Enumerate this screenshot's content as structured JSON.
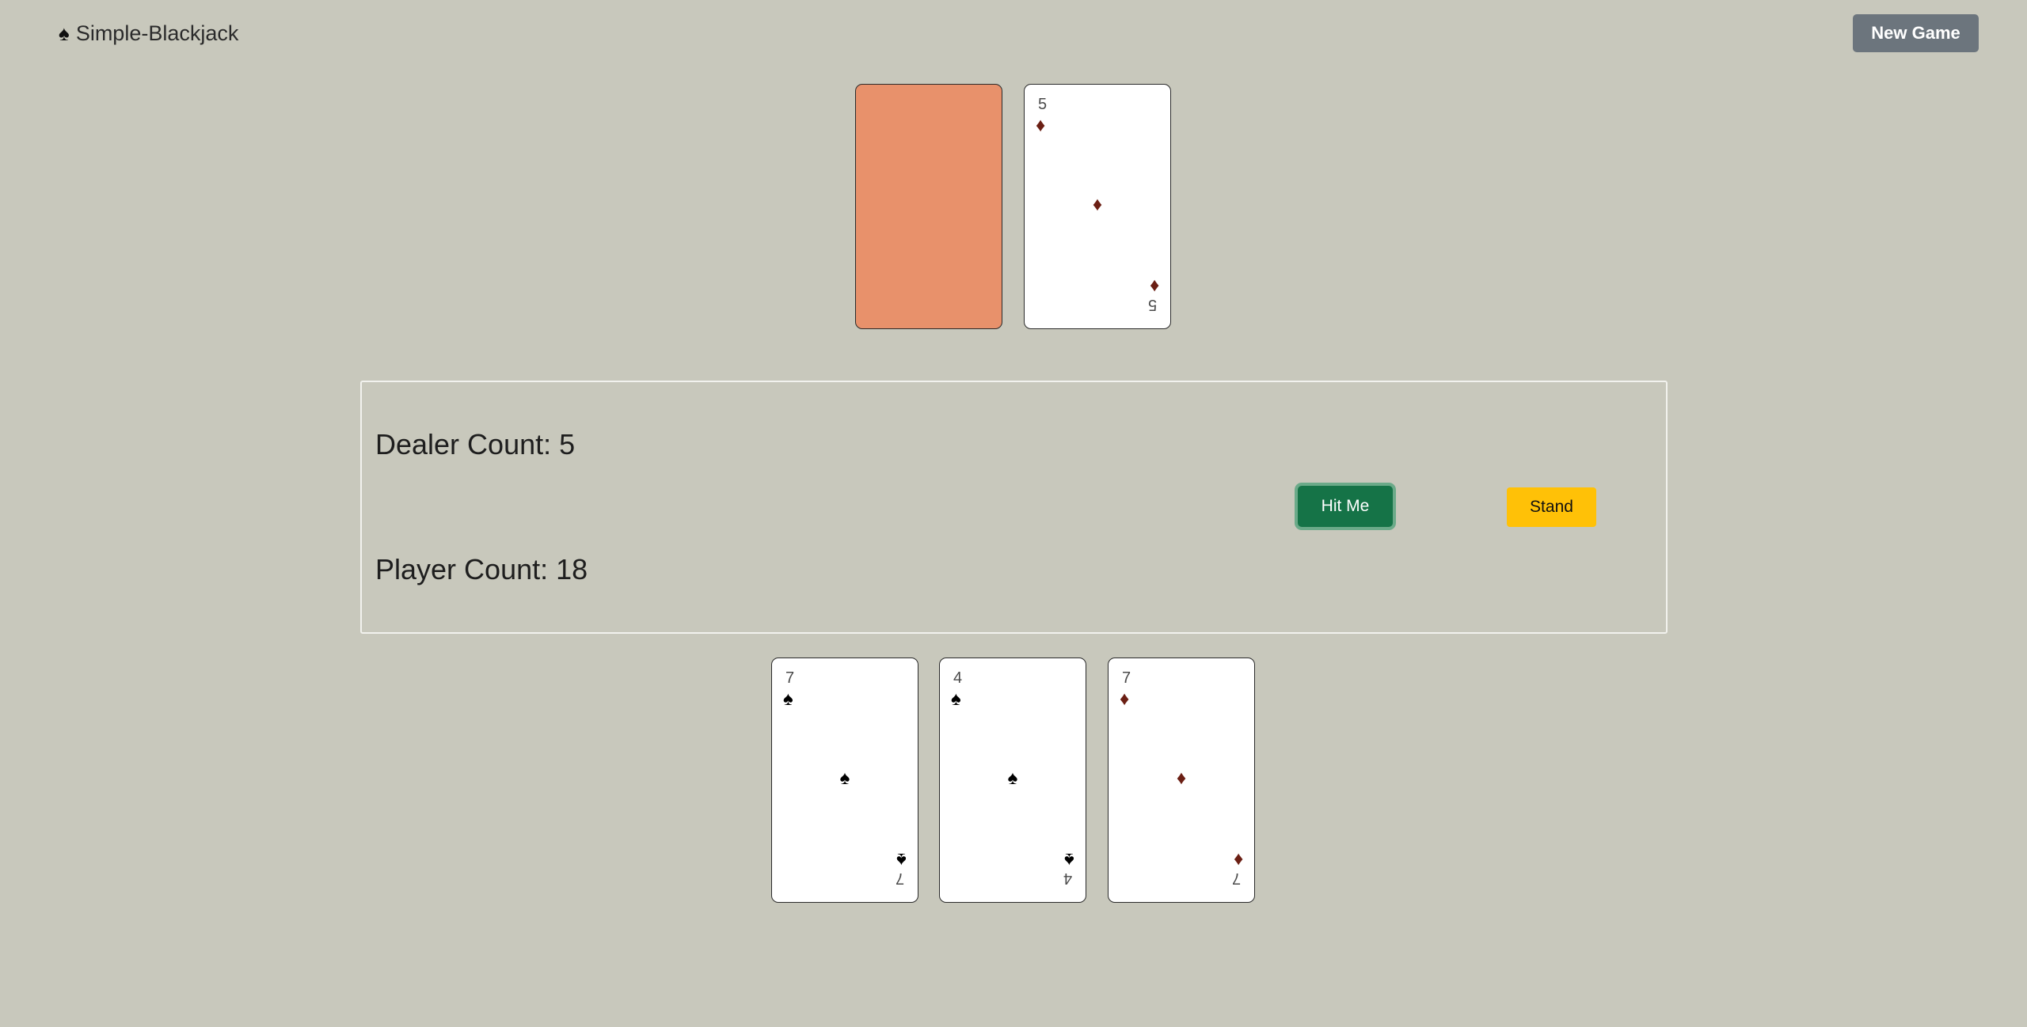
{
  "header": {
    "brand_icon": "spade-icon",
    "brand_icon_glyph": "♠",
    "brand_title": "Simple-Blackjack",
    "new_game_label": "New Game"
  },
  "dealer": {
    "hand": [
      {
        "face_down": true,
        "back_color": "#e8916b"
      },
      {
        "face_down": false,
        "rank": "5",
        "suit": "diamonds",
        "suit_glyph": "♦",
        "color": "red"
      }
    ]
  },
  "status": {
    "dealer_count_label": "Dealer Count: 5",
    "player_count_label": "Player Count: 18",
    "hit_label": "Hit Me",
    "stand_label": "Stand"
  },
  "player": {
    "hand": [
      {
        "rank": "7",
        "suit": "spades",
        "suit_glyph": "♠",
        "color": "black"
      },
      {
        "rank": "4",
        "suit": "spades",
        "suit_glyph": "♠",
        "color": "black"
      },
      {
        "rank": "7",
        "suit": "diamonds",
        "suit_glyph": "♦",
        "color": "red"
      }
    ]
  },
  "colors": {
    "background": "#c8c8bc",
    "card_back": "#e8916b",
    "hit_button": "#157347",
    "stand_button": "#ffc107",
    "new_game_button": "#6c757d",
    "red_suit": "#6b1f14"
  }
}
